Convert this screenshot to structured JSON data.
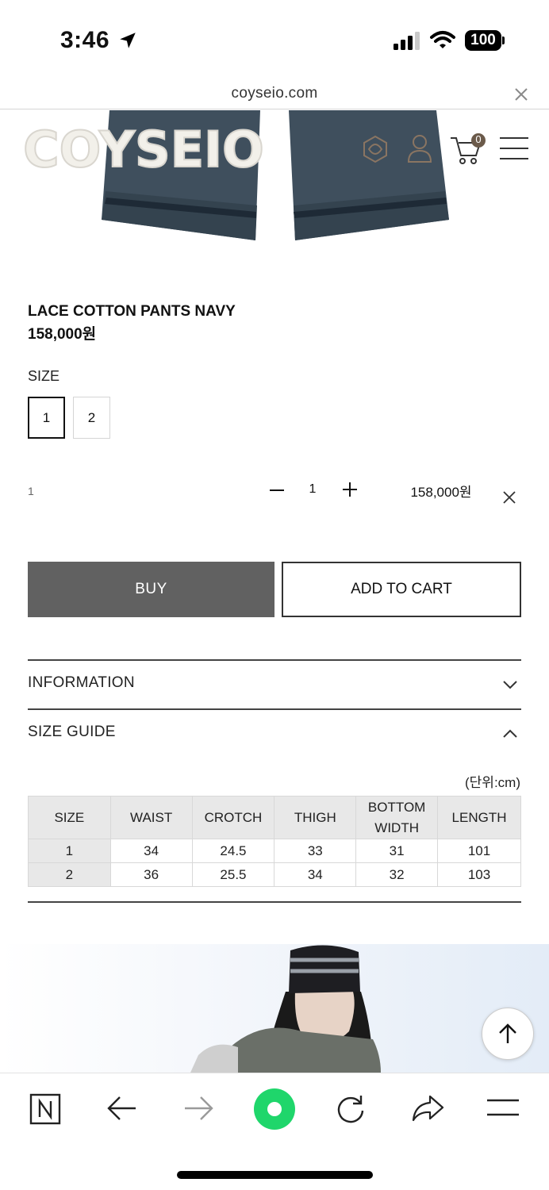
{
  "status_bar": {
    "time": "3:46",
    "battery": "100"
  },
  "browser": {
    "url": "coyseio.com"
  },
  "header": {
    "logo_text": "COYSEIO",
    "cart_count": "0"
  },
  "product": {
    "name": "LACE COTTON PANTS NAVY",
    "price": "158,000원",
    "size_label": "SIZE",
    "sizes": [
      "1",
      "2"
    ],
    "selected_size": "1"
  },
  "order_line": {
    "option": "1",
    "quantity": "1",
    "price": "158,000원"
  },
  "buttons": {
    "buy": "BUY",
    "add_to_cart": "ADD TO CART"
  },
  "accordions": {
    "information": "INFORMATION",
    "size_guide": "SIZE GUIDE"
  },
  "size_guide": {
    "unit_note": "(단위:cm)",
    "headers": [
      "SIZE",
      "WAIST",
      "CROTCH",
      "THIGH",
      "BOTTOM",
      "WIDTH",
      "LENGTH"
    ],
    "rows": [
      [
        "1",
        "34",
        "24.5",
        "33",
        "31",
        "101"
      ],
      [
        "2",
        "36",
        "25.5",
        "34",
        "32",
        "103"
      ]
    ]
  },
  "colors": {
    "buy_button": "#616161",
    "brand_icon": "#8a7562",
    "cart_badge": "#6b5a4a",
    "accent_green": "#1fd66b"
  }
}
